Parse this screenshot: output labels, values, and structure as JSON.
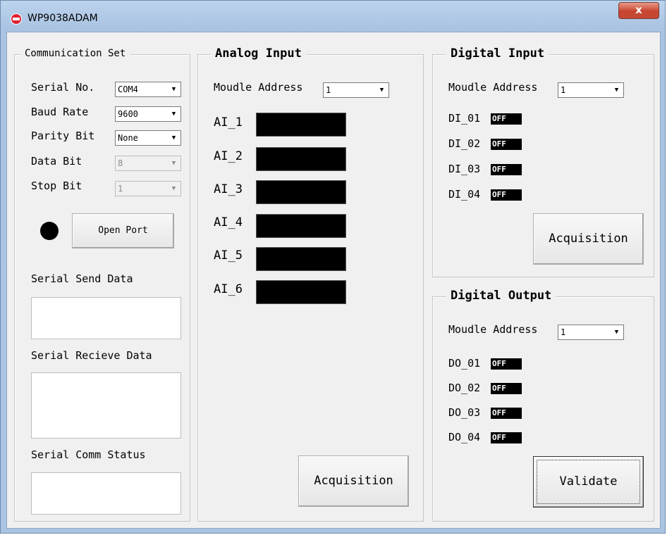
{
  "window": {
    "title": "WP9038ADAM",
    "close_glyph": "x"
  },
  "comm": {
    "title": "Communication Set",
    "serial_no_label": "Serial No.",
    "serial_no_value": "COM4",
    "baud_label": "Baud Rate",
    "baud_value": "9600",
    "parity_label": "Parity Bit",
    "parity_value": "None",
    "databit_label": "Data Bit",
    "databit_value": "8",
    "stopbit_label": "Stop Bit",
    "stopbit_value": "1",
    "open_port_label": "Open Port",
    "send_label": "Serial Send Data",
    "recv_label": "Serial Recieve Data",
    "status_label": "Serial Comm Status",
    "indicator_color": "#000000"
  },
  "analog": {
    "title": "Analog Input",
    "addr_label": "Moudle Address",
    "addr_value": "1",
    "channels": [
      "AI_1",
      "AI_2",
      "AI_3",
      "AI_4",
      "AI_5",
      "AI_6"
    ],
    "button": "Acquisition"
  },
  "digital_in": {
    "title": "Digital Input",
    "addr_label": "Moudle Address",
    "addr_value": "1",
    "channels": [
      {
        "label": "DI_01",
        "state": "OFF"
      },
      {
        "label": "DI_02",
        "state": "OFF"
      },
      {
        "label": "DI_03",
        "state": "OFF"
      },
      {
        "label": "DI_04",
        "state": "OFF"
      }
    ],
    "button": "Acquisition"
  },
  "digital_out": {
    "title": "Digital Output",
    "addr_label": "Moudle Address",
    "addr_value": "1",
    "channels": [
      {
        "label": "DO_01",
        "state": "OFF"
      },
      {
        "label": "DO_02",
        "state": "OFF"
      },
      {
        "label": "DO_03",
        "state": "OFF"
      },
      {
        "label": "DO_04",
        "state": "OFF"
      }
    ],
    "button": "Validate"
  },
  "dropdown_arrow": "▼"
}
